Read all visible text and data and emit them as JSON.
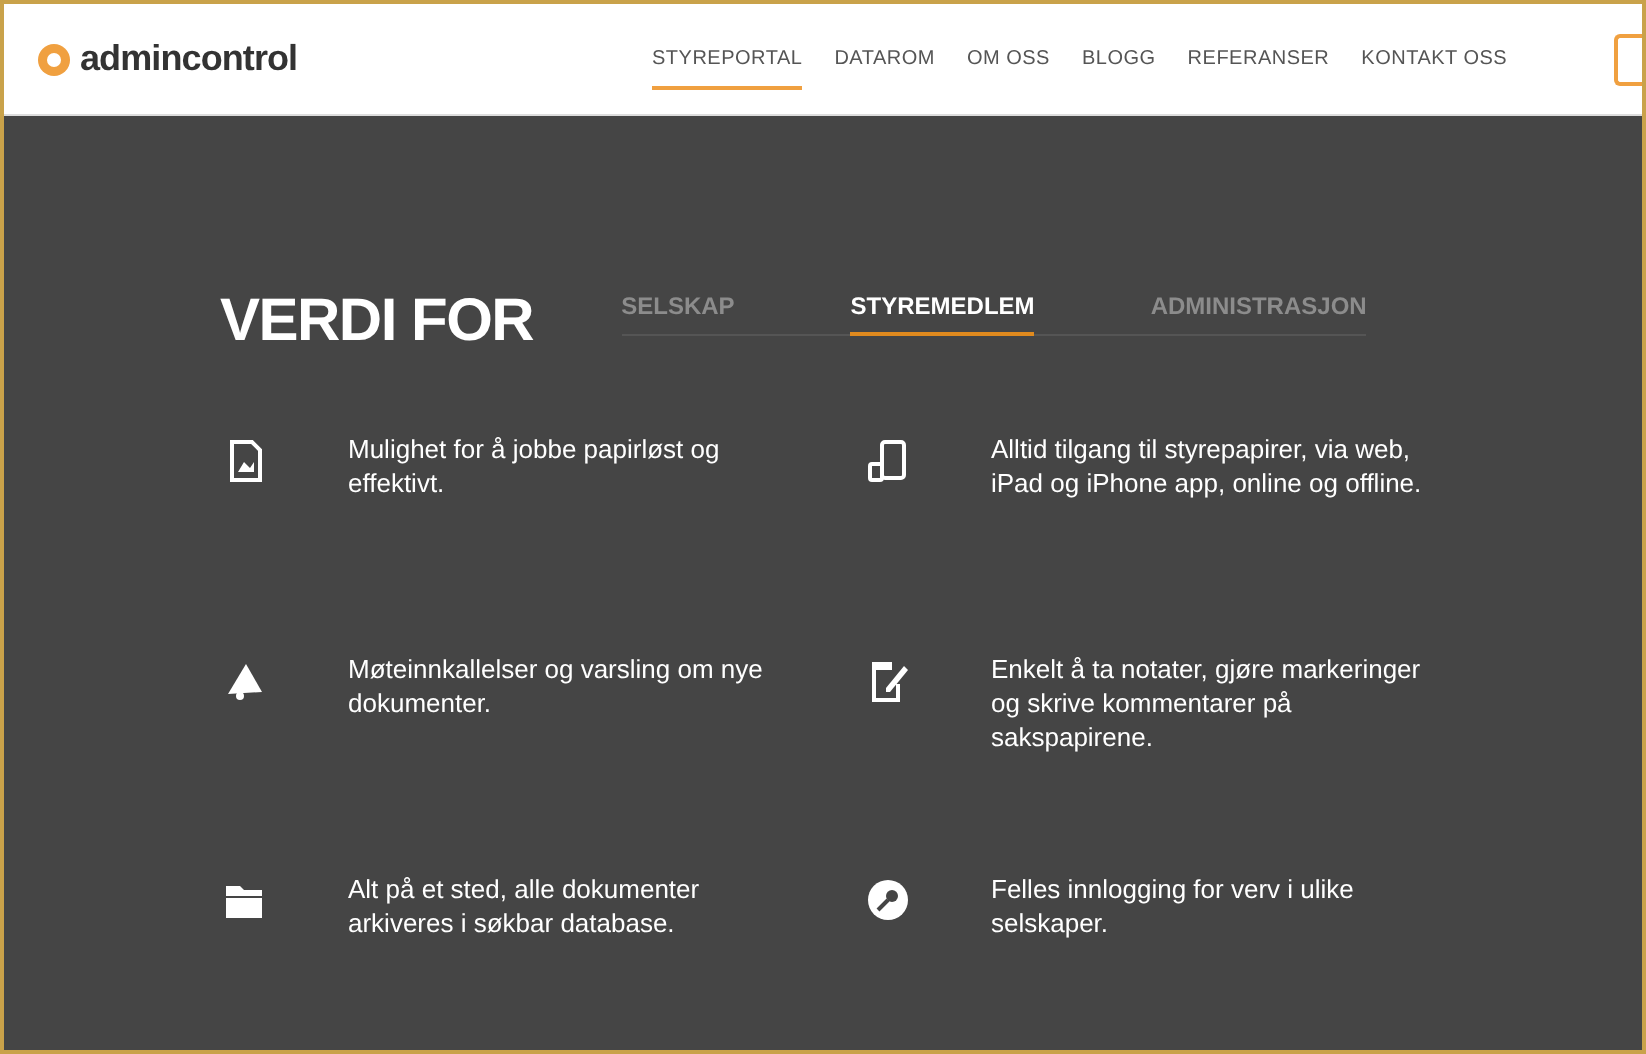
{
  "header": {
    "logo_text": "admincontrol",
    "nav": [
      {
        "label": "STYREPORTAL",
        "selected": true
      },
      {
        "label": "DATAROM",
        "selected": false
      },
      {
        "label": "OM OSS",
        "selected": false
      },
      {
        "label": "BLOGG",
        "selected": false
      },
      {
        "label": "REFERANSER",
        "selected": false
      },
      {
        "label": "KONTAKT OSS",
        "selected": false
      }
    ]
  },
  "section": {
    "title": "VERDI FOR",
    "tabs": [
      {
        "label": "SELSKAP",
        "selected": false
      },
      {
        "label": "STYREMEDLEM",
        "selected": true
      },
      {
        "label": "ADMINISTRASJON",
        "selected": false
      }
    ],
    "features": [
      {
        "text": "Mulighet for å jobbe papirløst og effektivt."
      },
      {
        "text": "Alltid tilgang til styrepapirer, via web, iPad og iPhone app, online og offline."
      },
      {
        "text": "Møteinnkallelser og varsling om nye dokumenter."
      },
      {
        "text": "Enkelt å ta notater, gjøre markeringer og skrive kommentarer på sakspapirene."
      },
      {
        "text": "Alt på et sted, alle dokumenter arkiveres i søkbar database."
      },
      {
        "text": "Felles innlogging for verv i ulike selskaper."
      }
    ]
  }
}
